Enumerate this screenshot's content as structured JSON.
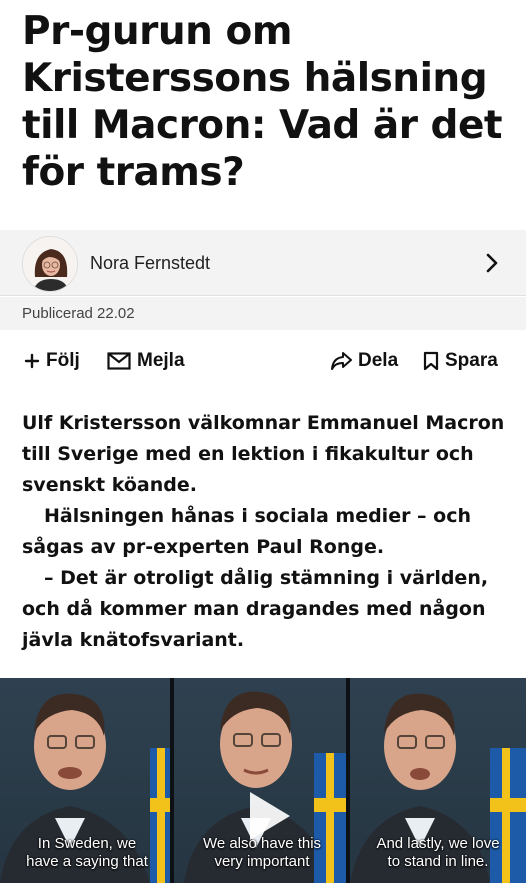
{
  "article": {
    "headline": "Pr-gurun om Kristerssons hälsning till Macron: Vad är det för trams?"
  },
  "author": {
    "name": "Nora Fernstedt",
    "icon": "chevron-right-icon"
  },
  "meta": {
    "published": "Publicerad 22.02"
  },
  "actions": {
    "follow": "Följ",
    "email": "Mejla",
    "share": "Dela",
    "save": "Spara"
  },
  "body": {
    "paragraphs": [
      "Ulf Kristersson välkomnar Emmanuel Macron till Sverige med en lektion i fikakultur och svenskt köande.",
      "Hälsningen hånas i sociala medier – och sågas av pr-experten Paul Ronge.",
      "– Det är otroligt dålig stämning i världen, och då kommer man dragandes med någon jävla knätofsvariant."
    ]
  },
  "video": {
    "captions": [
      {
        "line1": "In Sweden, we",
        "line2": "have a saying that"
      },
      {
        "line1": "We also have this",
        "line2": "very important"
      },
      {
        "line1": "And lastly, we love",
        "line2": "to stand in line."
      }
    ],
    "icon": "play-icon"
  },
  "colors": {
    "flag_blue": "#1d5aa8",
    "flag_yellow": "#f2c21b",
    "bar_background": "#f3f3f3"
  }
}
